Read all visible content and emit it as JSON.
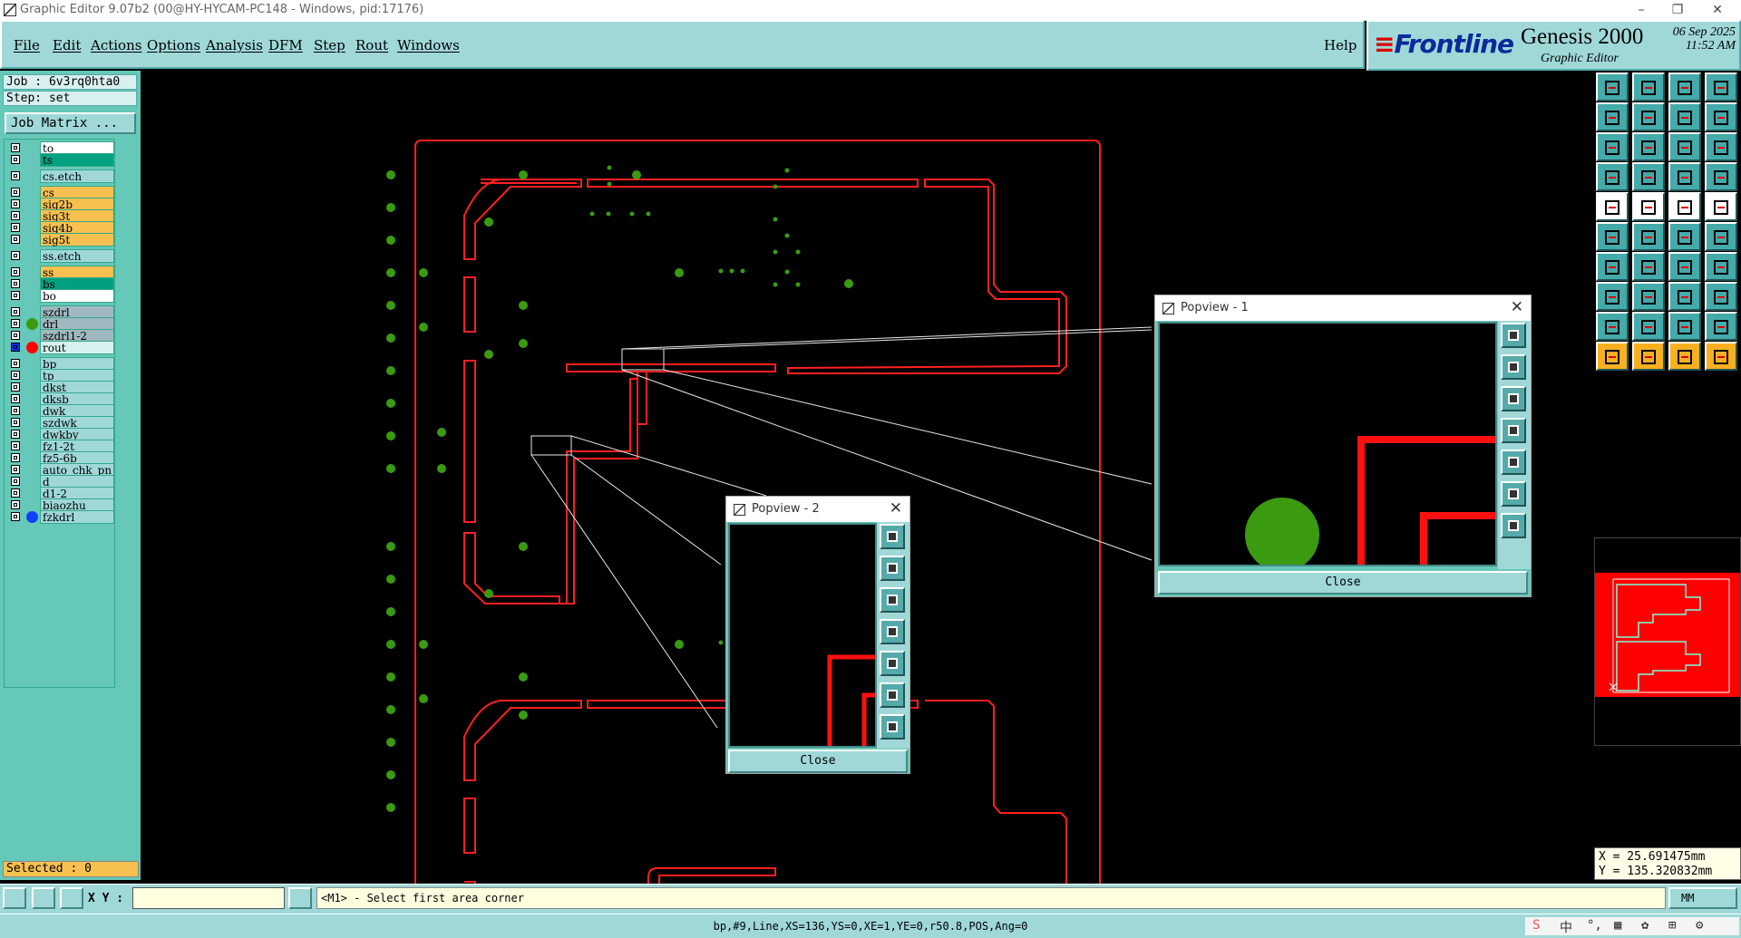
{
  "window": {
    "title": "Graphic Editor 9.07b2 (00@HY-HYCAM-PC148 - Windows, pid:17176)",
    "controls": [
      "–",
      "❐",
      "✕"
    ]
  },
  "menu": {
    "items": [
      "File",
      "Edit",
      "Actions",
      "Options",
      "Analysis",
      "DFM",
      "Step",
      "Rout",
      "Windows"
    ],
    "help": "Help"
  },
  "logo": {
    "brand": "Frontline",
    "product": "Genesis 2000",
    "subtitle": "Graphic Editor",
    "date": "06 Sep 2025",
    "time": "11:52 AM"
  },
  "job": {
    "job_line": "Job : 6v3rq0hta0",
    "step_line": "Step: set",
    "matrix_button": "Job Matrix ..."
  },
  "layers": [
    {
      "name": "to",
      "color": "#ffffff",
      "dot": null
    },
    {
      "name": "ts",
      "color": "#00a080",
      "dot": null
    },
    {
      "name": "cs.etch",
      "color": "#a0d8d8",
      "dot": null
    },
    {
      "name": "cs",
      "color": "#f8c050",
      "dot": null
    },
    {
      "name": "sig2b",
      "color": "#f8c050",
      "dot": null
    },
    {
      "name": "sig3t",
      "color": "#f8c050",
      "dot": null
    },
    {
      "name": "sig4b",
      "color": "#f8c050",
      "dot": null
    },
    {
      "name": "sig5t",
      "color": "#f8c050",
      "dot": null
    },
    {
      "name": "ss.etch",
      "color": "#a0d8d8",
      "dot": null
    },
    {
      "name": "ss",
      "color": "#f8c050",
      "dot": null
    },
    {
      "name": "bs",
      "color": "#00a080",
      "dot": null
    },
    {
      "name": "bo",
      "color": "#ffffff",
      "dot": null
    },
    {
      "name": "szdrl",
      "color": "#a0b8c0",
      "dot": null
    },
    {
      "name": "drl",
      "color": "#a0b8c0",
      "dot": "#3a9a10"
    },
    {
      "name": "szdrl1-2",
      "color": "#a0b8c0",
      "dot": null
    },
    {
      "name": "rout",
      "color": "#d8f0f0",
      "dot": "#ff0000",
      "active": true
    },
    {
      "name": "bp",
      "color": "#a0d8d8",
      "dot": null
    },
    {
      "name": "tp",
      "color": "#a0d8d8",
      "dot": null
    },
    {
      "name": "dkst",
      "color": "#a0d8d8",
      "dot": null
    },
    {
      "name": "dksb",
      "color": "#a0d8d8",
      "dot": null
    },
    {
      "name": "dwk",
      "color": "#a0d8d8",
      "dot": null
    },
    {
      "name": "szdwk",
      "color": "#a0d8d8",
      "dot": null
    },
    {
      "name": "dwkby",
      "color": "#a0d8d8",
      "dot": null
    },
    {
      "name": "fz1-2t",
      "color": "#a0d8d8",
      "dot": null
    },
    {
      "name": "fz5-6b",
      "color": "#a0d8d8",
      "dot": null
    },
    {
      "name": "auto_chk_pn",
      "color": "#a0d8d8",
      "dot": null
    },
    {
      "name": "d",
      "color": "#a0d8d8",
      "dot": null
    },
    {
      "name": "d1-2",
      "color": "#a0d8d8",
      "dot": null
    },
    {
      "name": "biaozhu",
      "color": "#a0d8d8",
      "dot": null
    },
    {
      "name": "fzkdrl",
      "color": "#a0d8d8",
      "dot": "#1040ff"
    }
  ],
  "selected": "Selected : 0",
  "popview1": {
    "title": "Popview - 1",
    "close": "Close"
  },
  "popview2": {
    "title": "Popview - 2",
    "close": "Close"
  },
  "coords": {
    "x": "X = 25.691475mm",
    "y": "Y = 135.320832mm"
  },
  "input": {
    "xy_label": "X Y :",
    "xy_value": "",
    "message": "<M1> - Select first area corner",
    "unit": "MM"
  },
  "status": "bp,#9,Line,XS=136,YS=0,XE=1,YE=0,r50.8,POS,Ang=0",
  "tray": [
    "S",
    "中",
    "°,",
    "▦",
    "✿",
    "⊞",
    "⚙"
  ],
  "colors": {
    "panel": "#a0d8d8",
    "layer_panel": "#66c8b8",
    "rout": "#ff0000",
    "drill": "#3a9a10",
    "background": "#000000"
  }
}
